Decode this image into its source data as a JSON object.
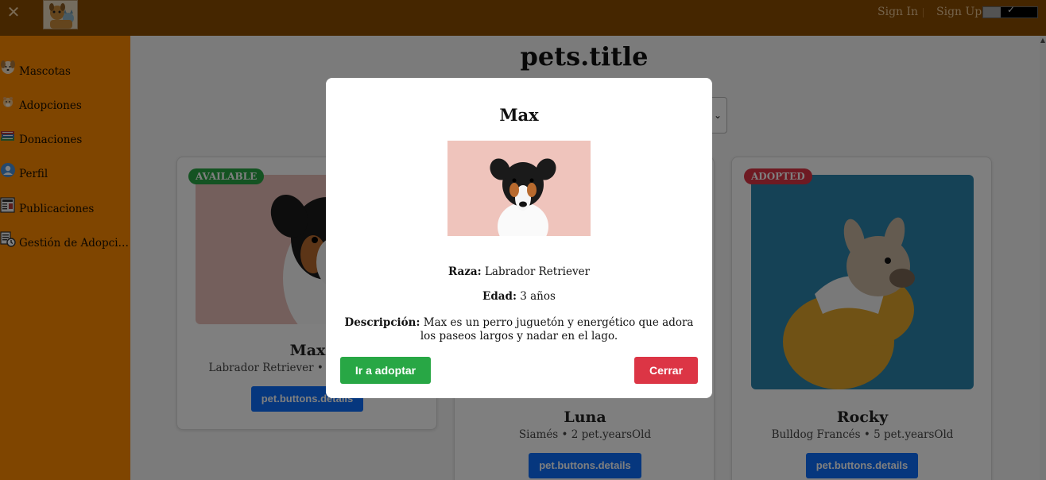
{
  "topbar": {
    "close_glyph": "✕",
    "sign_in": "Sign In",
    "sign_up": "Sign Up",
    "toggle_check": "✓",
    "bg_color": "#8a4d00"
  },
  "sidebar": {
    "bg_color": "#ff8a00",
    "items": [
      {
        "label": "Mascotas",
        "icon": "dog-face-icon"
      },
      {
        "label": "Adopciones",
        "icon": "hamster-icon"
      },
      {
        "label": "Donaciones",
        "icon": "books-icon"
      },
      {
        "label": "Perfil",
        "icon": "user-icon"
      },
      {
        "label": "Publicaciones",
        "icon": "newspaper-icon"
      },
      {
        "label": "Gestión de Adopci…",
        "icon": "adoption-management-icon"
      }
    ]
  },
  "main": {
    "title": "pets.title",
    "cards": [
      {
        "name": "Max",
        "subtitle": "Labrador Retriever • 3 pet.yearsOld",
        "badge": "AVAILABLE",
        "badge_color": "#28a745",
        "button": "pet.buttons.details"
      },
      {
        "name": "Luna",
        "subtitle": "Siamés • 2 pet.yearsOld",
        "badge": "",
        "button": "pet.buttons.details"
      },
      {
        "name": "Rocky",
        "subtitle": "Bulldog Francés • 5 pet.yearsOld",
        "badge": "ADOPTED",
        "badge_color": "#dc3545",
        "button": "pet.buttons.details"
      }
    ]
  },
  "modal": {
    "title": "Max",
    "breed_label": "Raza:",
    "breed": "Labrador Retriever",
    "age_label": "Edad:",
    "age": "3 años",
    "description_label": "Descripción:",
    "description": "Max es un perro juguetón y energético que adora los paseos largos y nadar en el lago.",
    "adopt_button": "Ir a adoptar",
    "close_button": "Cerrar"
  }
}
